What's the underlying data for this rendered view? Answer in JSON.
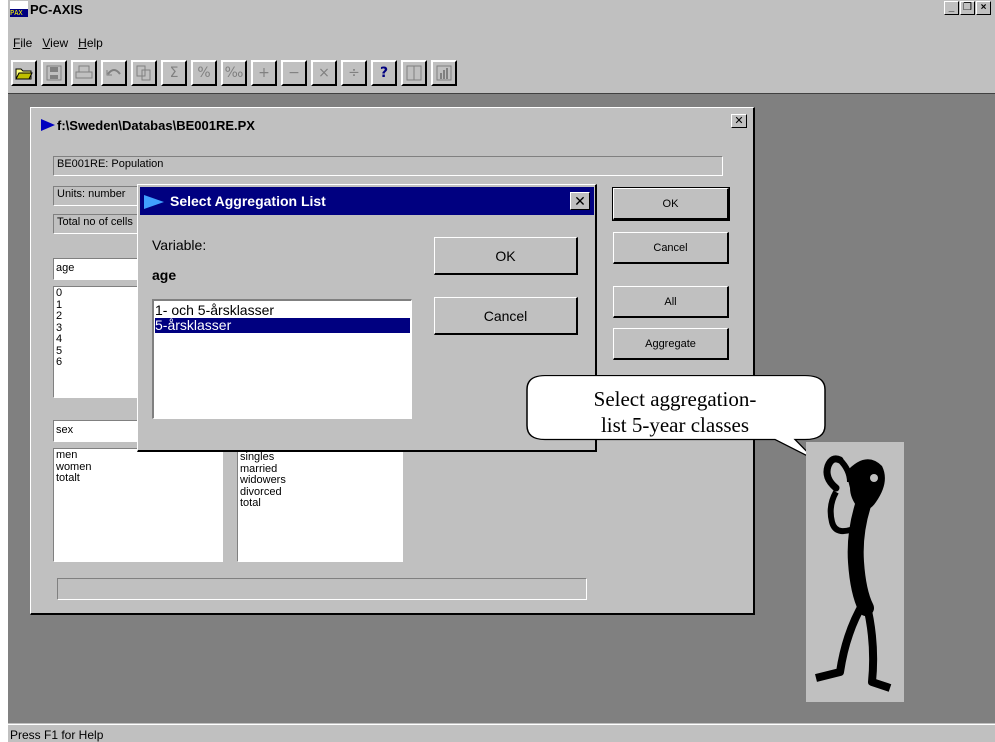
{
  "app": {
    "title": "PC-AXIS",
    "logo_text": "PAX",
    "window_buttons": [
      "_",
      "°",
      "×"
    ]
  },
  "menu": [
    {
      "label": "File",
      "mnemonic": "F"
    },
    {
      "label": "View",
      "mnemonic": "V"
    },
    {
      "label": "Help",
      "mnemonic": "H"
    }
  ],
  "toolbar": [
    {
      "name": "open",
      "glyph": "📂"
    },
    {
      "name": "save",
      "glyph": "▣"
    },
    {
      "name": "print",
      "glyph": "⎙"
    },
    {
      "name": "undo",
      "glyph": "↶"
    },
    {
      "name": "copy",
      "glyph": "❐"
    },
    {
      "name": "sum",
      "glyph": "Σ"
    },
    {
      "name": "percent",
      "glyph": "%"
    },
    {
      "name": "permille",
      "glyph": "‰"
    },
    {
      "name": "add",
      "glyph": "+"
    },
    {
      "name": "subtract",
      "glyph": "−"
    },
    {
      "name": "multiply",
      "glyph": "×"
    },
    {
      "name": "divide",
      "glyph": "÷"
    },
    {
      "name": "help",
      "glyph": "?"
    },
    {
      "name": "columns",
      "glyph": "◫"
    },
    {
      "name": "chart",
      "glyph": "▐"
    }
  ],
  "child_window": {
    "title": "f:\\Sweden\\Databas\\BE001RE.PX",
    "table_title": "BE001RE: Population",
    "units": "Units: number",
    "total": "Total no of cells",
    "var1_name": "age",
    "var1_values": [
      "0",
      "1",
      "2",
      "3",
      "4",
      "5",
      "6"
    ],
    "var2_name": "sex",
    "var2_values": [
      "men",
      "women",
      "totalt"
    ],
    "var3_values": [
      "singles",
      "married",
      "widowers",
      "divorced",
      "total"
    ],
    "buttons": {
      "ok": "OK",
      "cancel": "Cancel",
      "all": "All",
      "aggregate": "Aggregate"
    }
  },
  "dialog": {
    "title": "Select Aggregation List",
    "variable_label": "Variable:",
    "variable_value": "age",
    "options": [
      "1- och 5-årsklasser",
      "5-årsklasser"
    ],
    "selected_index": 1,
    "ok": "OK",
    "cancel": "Cancel"
  },
  "callout": {
    "line1": "Select aggregation-",
    "line2": "list 5-year classes"
  },
  "status": "Press F1 for Help"
}
